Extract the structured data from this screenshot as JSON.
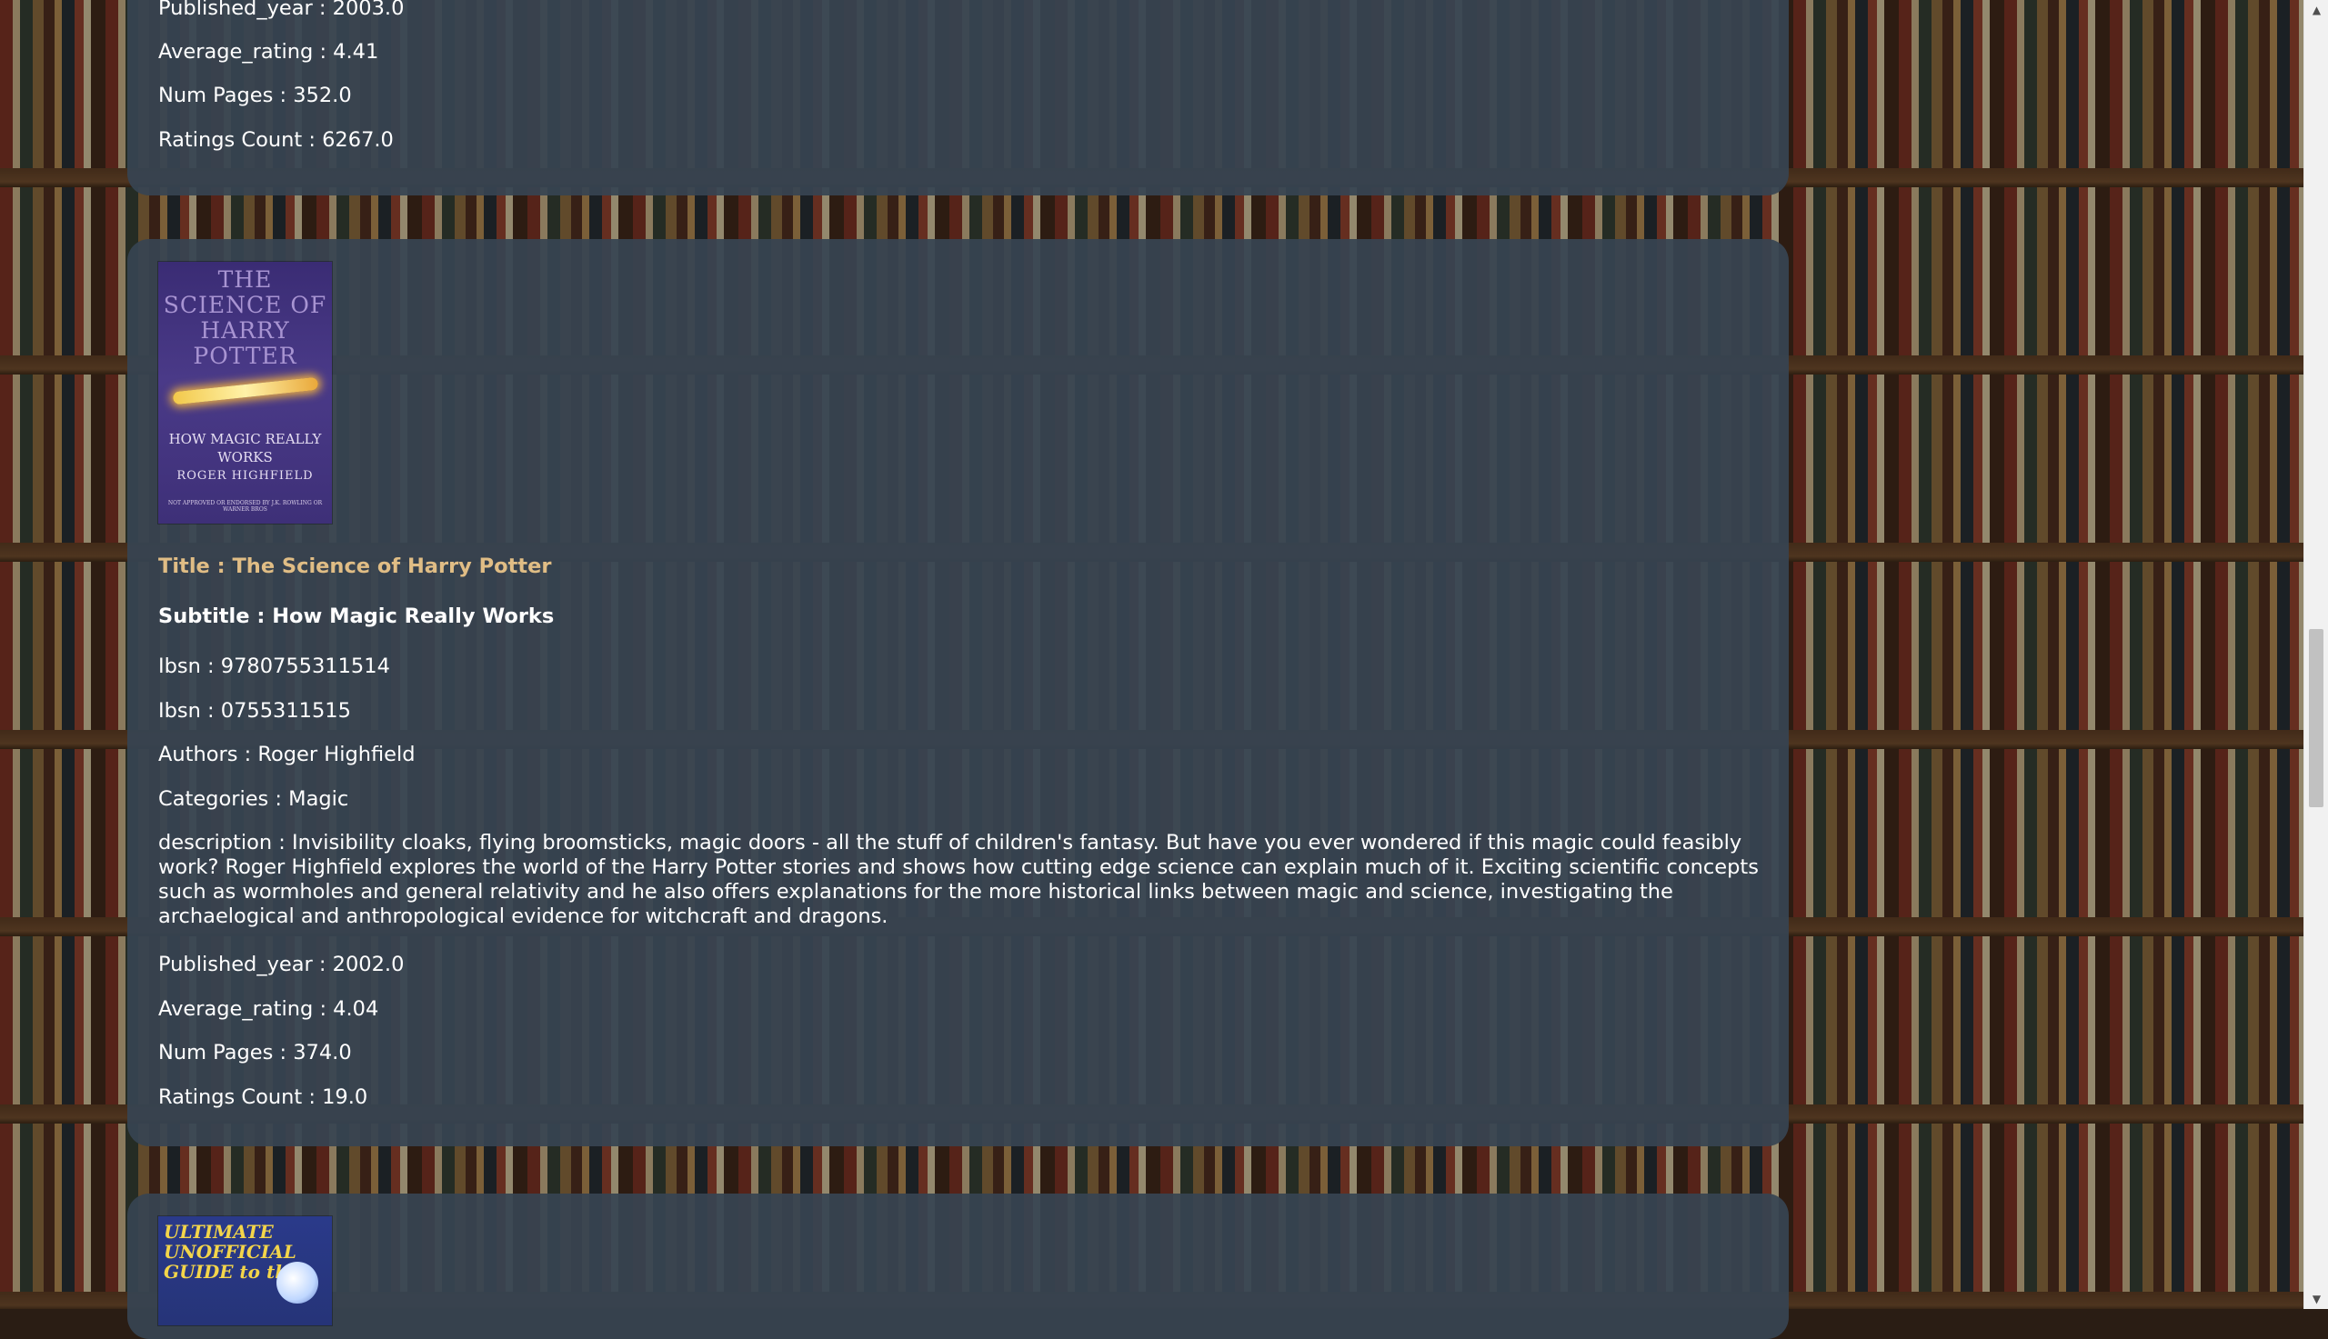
{
  "books": [
    {
      "published_year": "Published_year : 2003.0",
      "average_rating": "Average_rating : 4.41",
      "num_pages": "Num Pages : 352.0",
      "ratings_count": "Ratings Count : 6267.0"
    },
    {
      "cover": {
        "title": "THE SCIENCE OF HARRY POTTER",
        "subtitle": "HOW MAGIC REALLY WORKS",
        "author": "ROGER HIGHFIELD",
        "note": "NOT APPROVED OR ENDORSED BY J.K. ROWLING OR WARNER BROS"
      },
      "title": "Title : The Science of Harry Potter",
      "subtitle": "Subtitle : How Magic Really Works",
      "isbn13": "Ibsn : 9780755311514",
      "isbn10": "Ibsn : 0755311515",
      "authors": "Authors : Roger Highfield",
      "categories": "Categories : Magic",
      "description": "description : Invisibility cloaks, flying broomsticks, magic doors - all the stuff of children's fantasy. But have you ever wondered if this magic could feasibly work? Roger Highfield explores the world of the Harry Potter stories and shows how cutting edge science can explain much of it. Exciting scientific concepts such as wormholes and general relativity and he also offers explanations for the more historical links between magic and science, investigating the archaelogical and anthropological evidence for witchcraft and dragons.",
      "published_year": "Published_year : 2002.0",
      "average_rating": "Average_rating : 4.04",
      "num_pages": "Num Pages : 374.0",
      "ratings_count": "Ratings Count : 19.0"
    },
    {
      "cover": {
        "title": "ULTIMATE UNOFFICIAL GUIDE to the"
      }
    }
  ],
  "scrollbar": {
    "up_icon": "arrow-up-icon",
    "down_icon": "arrow-down-icon"
  },
  "colors": {
    "card_bg": "#374452",
    "title_color": "#e0bd85",
    "text_color": "#ffffff"
  }
}
